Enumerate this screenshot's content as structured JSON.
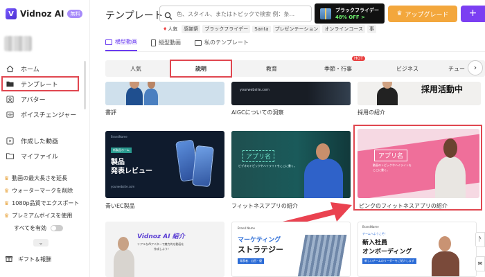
{
  "brand": {
    "name": "Vidnoz AI",
    "badge": "無料"
  },
  "sidebar": {
    "items": [
      {
        "label": "ホーム",
        "icon": "home-icon"
      },
      {
        "label": "テンプレート",
        "icon": "template-folder-icon"
      },
      {
        "label": "アバター",
        "icon": "avatar-icon"
      },
      {
        "label": "ボイスチェンジャー",
        "icon": "voice-changer-icon"
      },
      {
        "label": "作成した動画",
        "icon": "video-play-icon"
      },
      {
        "label": "マイファイル",
        "icon": "folder-icon"
      }
    ],
    "perks": [
      "動画の最大長さを延長",
      "ウォーターマークを削除",
      "1080p品質でエクスポート",
      "プレミアムボイスを使用"
    ],
    "enable_all": "すべてを有効",
    "gift": "ギフト＆報酬"
  },
  "header": {
    "title": "テンプレート",
    "search_placeholder": "色、スタイル、またはトピックで検索 例：条...",
    "promo_line1": "ブラックフライデー",
    "promo_line2": "48% OFF >",
    "upgrade": "アップグレード",
    "plus": "+"
  },
  "tags": [
    "人気",
    "感謝祭",
    "ブラックフライデー",
    "Santa",
    "プレゼンテーション",
    "オンラインコース",
    "事"
  ],
  "view_tabs": [
    {
      "label": "横型動画",
      "active": true
    },
    {
      "label": "縦型動画",
      "active": false
    },
    {
      "label": "私のテンプレート",
      "active": false
    }
  ],
  "categories": [
    {
      "label": "人気"
    },
    {
      "label": "説明",
      "active": true
    },
    {
      "label": "教育"
    },
    {
      "label": "季節・行事",
      "badge": "HOT"
    },
    {
      "label": "ビジネス"
    },
    {
      "label": "チュー"
    }
  ],
  "cards": {
    "row1": [
      "書評",
      "AIGCについての洞察",
      "採用の紹介"
    ],
    "row1_thumb": {
      "url": "yourwebsite.com",
      "recruit": "採用活動中"
    },
    "row2": [
      "青いEC製品",
      "フィットネスアプリの紹介",
      "ピンクのフィットネスアプリの紹介"
    ],
    "c21": {
      "brand": "BrandName",
      "tag": "新製品ホーム",
      "title1": "製品",
      "title2": "発表レビュー",
      "url": "yourwebsite.com"
    },
    "c22": {
      "app": "アプリ名",
      "desc": "ビデオのトピックやハイライトをここに書く。"
    },
    "c23": {
      "app": "アプリ名",
      "desc1": "動画のトピックやハイライトを",
      "desc2": "ここに書く。"
    },
    "c31": {
      "title": "Vidnoz AI 紹介",
      "sub1": "リアルなAIアバターで魅力的な動画を",
      "sub2": "作成しよう！"
    },
    "c32": {
      "brand": "Brand Name",
      "t1": "マーケティング",
      "t2": "ストラテジー",
      "tag": "発表者：山田・優"
    },
    "c33": {
      "brand": "BrandName",
      "kicker": "チームへようこそ！",
      "t1": "新入社員",
      "t2": "オンボーディング",
      "sub": "新しいチームのリーダーをご紹介します"
    }
  },
  "colors": {
    "accent": "#6a3cf0",
    "highlight": "#e0464f",
    "upgrade": "#f3a73c",
    "pink_card": "#f06292",
    "teal_card": "#1f3f44",
    "arrow": "#ea4250"
  }
}
